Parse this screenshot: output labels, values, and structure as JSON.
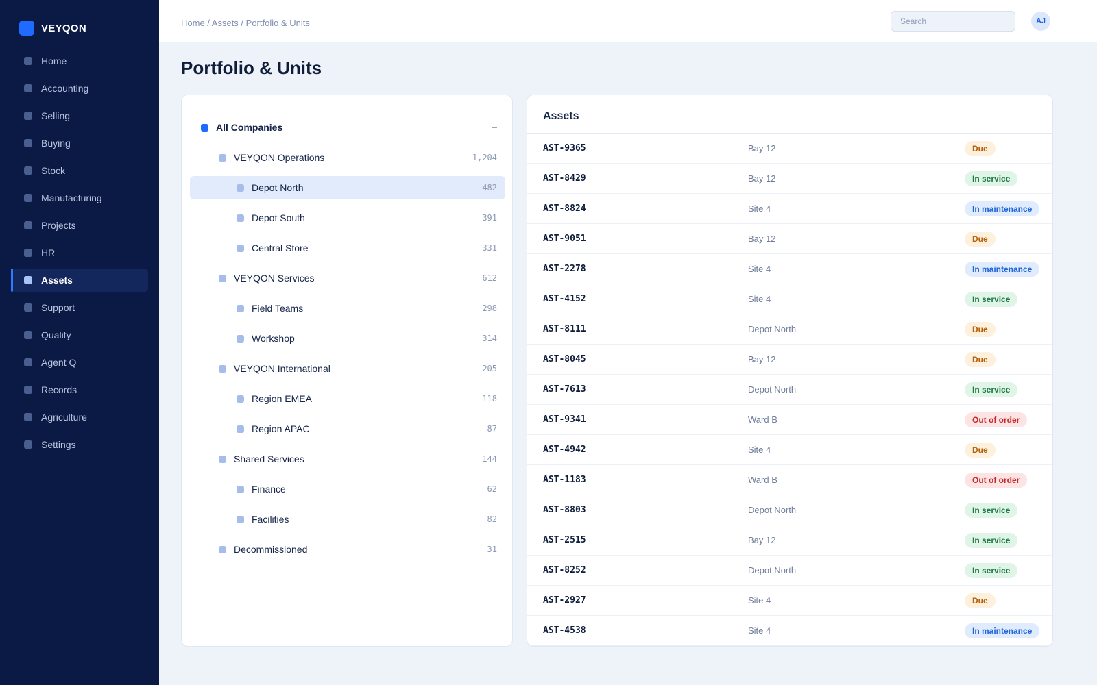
{
  "brand": {
    "name": "VEYQON",
    "accent": "#1f6bff"
  },
  "sidebar": {
    "items": [
      {
        "label": "Home",
        "active": false
      },
      {
        "label": "Accounting",
        "active": false
      },
      {
        "label": "Selling",
        "active": false
      },
      {
        "label": "Buying",
        "active": false
      },
      {
        "label": "Stock",
        "active": false
      },
      {
        "label": "Manufacturing",
        "active": false
      },
      {
        "label": "Projects",
        "active": false
      },
      {
        "label": "HR",
        "active": false
      },
      {
        "label": "Assets",
        "active": true
      },
      {
        "label": "Support",
        "active": false
      },
      {
        "label": "Quality",
        "active": false
      },
      {
        "label": "Agent Q",
        "active": false
      },
      {
        "label": "Records",
        "active": false
      },
      {
        "label": "Agriculture",
        "active": false
      },
      {
        "label": "Settings",
        "active": false
      }
    ]
  },
  "topbar": {
    "breadcrumb": "Home / Assets / Portfolio & Units",
    "search_placeholder": "Search",
    "avatar_initials": "AJ"
  },
  "page": {
    "title": "Portfolio & Units"
  },
  "tree": {
    "nodes": [
      {
        "label": "All Companies",
        "count": "–",
        "level": 0,
        "selected": false
      },
      {
        "label": "VEYQON Operations",
        "count": "1,204",
        "level": 1,
        "selected": false
      },
      {
        "label": "Depot North",
        "count": "482",
        "level": 2,
        "selected": true
      },
      {
        "label": "Depot South",
        "count": "391",
        "level": 2,
        "selected": false
      },
      {
        "label": "Central Store",
        "count": "331",
        "level": 2,
        "selected": false
      },
      {
        "label": "VEYQON Services",
        "count": "612",
        "level": 1,
        "selected": false
      },
      {
        "label": "Field Teams",
        "count": "298",
        "level": 2,
        "selected": false
      },
      {
        "label": "Workshop",
        "count": "314",
        "level": 2,
        "selected": false
      },
      {
        "label": "VEYQON International",
        "count": "205",
        "level": 1,
        "selected": false
      },
      {
        "label": "Region EMEA",
        "count": "118",
        "level": 2,
        "selected": false
      },
      {
        "label": "Region APAC",
        "count": "87",
        "level": 2,
        "selected": false
      },
      {
        "label": "Shared Services",
        "count": "144",
        "level": 1,
        "selected": false
      },
      {
        "label": "Finance",
        "count": "62",
        "level": 2,
        "selected": false
      },
      {
        "label": "Facilities",
        "count": "82",
        "level": 2,
        "selected": false
      },
      {
        "label": "Decommissioned",
        "count": "31",
        "level": 1,
        "selected": false
      }
    ]
  },
  "assets": {
    "title": "Assets",
    "status_colors": {
      "Due": "#b5600b",
      "In service": "#1b7a43",
      "In maintenance": "#1f66d6",
      "Out of order": "#c52a2a"
    },
    "rows": [
      {
        "id": "AST-9365",
        "location": "Bay 12",
        "status": "Due"
      },
      {
        "id": "AST-8429",
        "location": "Bay 12",
        "status": "In service"
      },
      {
        "id": "AST-8824",
        "location": "Site 4",
        "status": "In maintenance"
      },
      {
        "id": "AST-9051",
        "location": "Bay 12",
        "status": "Due"
      },
      {
        "id": "AST-2278",
        "location": "Site 4",
        "status": "In maintenance"
      },
      {
        "id": "AST-4152",
        "location": "Site 4",
        "status": "In service"
      },
      {
        "id": "AST-8111",
        "location": "Depot North",
        "status": "Due"
      },
      {
        "id": "AST-8045",
        "location": "Bay 12",
        "status": "Due"
      },
      {
        "id": "AST-7613",
        "location": "Depot North",
        "status": "In service"
      },
      {
        "id": "AST-9341",
        "location": "Ward B",
        "status": "Out of order"
      },
      {
        "id": "AST-4942",
        "location": "Site 4",
        "status": "Due"
      },
      {
        "id": "AST-1183",
        "location": "Ward B",
        "status": "Out of order"
      },
      {
        "id": "AST-8803",
        "location": "Depot North",
        "status": "In service"
      },
      {
        "id": "AST-2515",
        "location": "Bay 12",
        "status": "In service"
      },
      {
        "id": "AST-8252",
        "location": "Depot North",
        "status": "In service"
      },
      {
        "id": "AST-2927",
        "location": "Site 4",
        "status": "Due"
      },
      {
        "id": "AST-4538",
        "location": "Site 4",
        "status": "In maintenance"
      }
    ]
  }
}
